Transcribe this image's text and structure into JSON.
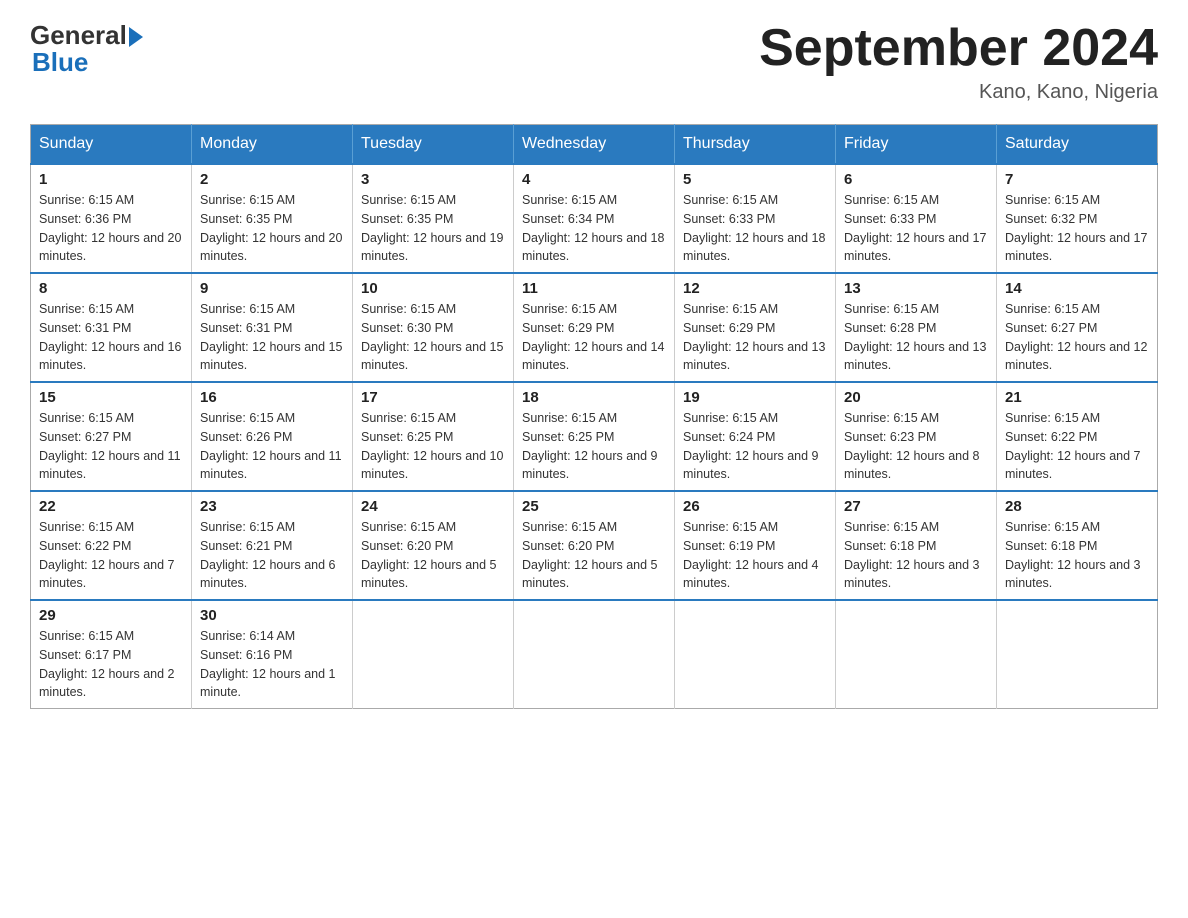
{
  "header": {
    "logo_general": "General",
    "logo_blue": "Blue",
    "month_title": "September 2024",
    "location": "Kano, Kano, Nigeria"
  },
  "weekdays": [
    "Sunday",
    "Monday",
    "Tuesday",
    "Wednesday",
    "Thursday",
    "Friday",
    "Saturday"
  ],
  "weeks": [
    [
      {
        "day": "1",
        "sunrise": "Sunrise: 6:15 AM",
        "sunset": "Sunset: 6:36 PM",
        "daylight": "Daylight: 12 hours and 20 minutes."
      },
      {
        "day": "2",
        "sunrise": "Sunrise: 6:15 AM",
        "sunset": "Sunset: 6:35 PM",
        "daylight": "Daylight: 12 hours and 20 minutes."
      },
      {
        "day": "3",
        "sunrise": "Sunrise: 6:15 AM",
        "sunset": "Sunset: 6:35 PM",
        "daylight": "Daylight: 12 hours and 19 minutes."
      },
      {
        "day": "4",
        "sunrise": "Sunrise: 6:15 AM",
        "sunset": "Sunset: 6:34 PM",
        "daylight": "Daylight: 12 hours and 18 minutes."
      },
      {
        "day": "5",
        "sunrise": "Sunrise: 6:15 AM",
        "sunset": "Sunset: 6:33 PM",
        "daylight": "Daylight: 12 hours and 18 minutes."
      },
      {
        "day": "6",
        "sunrise": "Sunrise: 6:15 AM",
        "sunset": "Sunset: 6:33 PM",
        "daylight": "Daylight: 12 hours and 17 minutes."
      },
      {
        "day": "7",
        "sunrise": "Sunrise: 6:15 AM",
        "sunset": "Sunset: 6:32 PM",
        "daylight": "Daylight: 12 hours and 17 minutes."
      }
    ],
    [
      {
        "day": "8",
        "sunrise": "Sunrise: 6:15 AM",
        "sunset": "Sunset: 6:31 PM",
        "daylight": "Daylight: 12 hours and 16 minutes."
      },
      {
        "day": "9",
        "sunrise": "Sunrise: 6:15 AM",
        "sunset": "Sunset: 6:31 PM",
        "daylight": "Daylight: 12 hours and 15 minutes."
      },
      {
        "day": "10",
        "sunrise": "Sunrise: 6:15 AM",
        "sunset": "Sunset: 6:30 PM",
        "daylight": "Daylight: 12 hours and 15 minutes."
      },
      {
        "day": "11",
        "sunrise": "Sunrise: 6:15 AM",
        "sunset": "Sunset: 6:29 PM",
        "daylight": "Daylight: 12 hours and 14 minutes."
      },
      {
        "day": "12",
        "sunrise": "Sunrise: 6:15 AM",
        "sunset": "Sunset: 6:29 PM",
        "daylight": "Daylight: 12 hours and 13 minutes."
      },
      {
        "day": "13",
        "sunrise": "Sunrise: 6:15 AM",
        "sunset": "Sunset: 6:28 PM",
        "daylight": "Daylight: 12 hours and 13 minutes."
      },
      {
        "day": "14",
        "sunrise": "Sunrise: 6:15 AM",
        "sunset": "Sunset: 6:27 PM",
        "daylight": "Daylight: 12 hours and 12 minutes."
      }
    ],
    [
      {
        "day": "15",
        "sunrise": "Sunrise: 6:15 AM",
        "sunset": "Sunset: 6:27 PM",
        "daylight": "Daylight: 12 hours and 11 minutes."
      },
      {
        "day": "16",
        "sunrise": "Sunrise: 6:15 AM",
        "sunset": "Sunset: 6:26 PM",
        "daylight": "Daylight: 12 hours and 11 minutes."
      },
      {
        "day": "17",
        "sunrise": "Sunrise: 6:15 AM",
        "sunset": "Sunset: 6:25 PM",
        "daylight": "Daylight: 12 hours and 10 minutes."
      },
      {
        "day": "18",
        "sunrise": "Sunrise: 6:15 AM",
        "sunset": "Sunset: 6:25 PM",
        "daylight": "Daylight: 12 hours and 9 minutes."
      },
      {
        "day": "19",
        "sunrise": "Sunrise: 6:15 AM",
        "sunset": "Sunset: 6:24 PM",
        "daylight": "Daylight: 12 hours and 9 minutes."
      },
      {
        "day": "20",
        "sunrise": "Sunrise: 6:15 AM",
        "sunset": "Sunset: 6:23 PM",
        "daylight": "Daylight: 12 hours and 8 minutes."
      },
      {
        "day": "21",
        "sunrise": "Sunrise: 6:15 AM",
        "sunset": "Sunset: 6:22 PM",
        "daylight": "Daylight: 12 hours and 7 minutes."
      }
    ],
    [
      {
        "day": "22",
        "sunrise": "Sunrise: 6:15 AM",
        "sunset": "Sunset: 6:22 PM",
        "daylight": "Daylight: 12 hours and 7 minutes."
      },
      {
        "day": "23",
        "sunrise": "Sunrise: 6:15 AM",
        "sunset": "Sunset: 6:21 PM",
        "daylight": "Daylight: 12 hours and 6 minutes."
      },
      {
        "day": "24",
        "sunrise": "Sunrise: 6:15 AM",
        "sunset": "Sunset: 6:20 PM",
        "daylight": "Daylight: 12 hours and 5 minutes."
      },
      {
        "day": "25",
        "sunrise": "Sunrise: 6:15 AM",
        "sunset": "Sunset: 6:20 PM",
        "daylight": "Daylight: 12 hours and 5 minutes."
      },
      {
        "day": "26",
        "sunrise": "Sunrise: 6:15 AM",
        "sunset": "Sunset: 6:19 PM",
        "daylight": "Daylight: 12 hours and 4 minutes."
      },
      {
        "day": "27",
        "sunrise": "Sunrise: 6:15 AM",
        "sunset": "Sunset: 6:18 PM",
        "daylight": "Daylight: 12 hours and 3 minutes."
      },
      {
        "day": "28",
        "sunrise": "Sunrise: 6:15 AM",
        "sunset": "Sunset: 6:18 PM",
        "daylight": "Daylight: 12 hours and 3 minutes."
      }
    ],
    [
      {
        "day": "29",
        "sunrise": "Sunrise: 6:15 AM",
        "sunset": "Sunset: 6:17 PM",
        "daylight": "Daylight: 12 hours and 2 minutes."
      },
      {
        "day": "30",
        "sunrise": "Sunrise: 6:14 AM",
        "sunset": "Sunset: 6:16 PM",
        "daylight": "Daylight: 12 hours and 1 minute."
      },
      null,
      null,
      null,
      null,
      null
    ]
  ]
}
